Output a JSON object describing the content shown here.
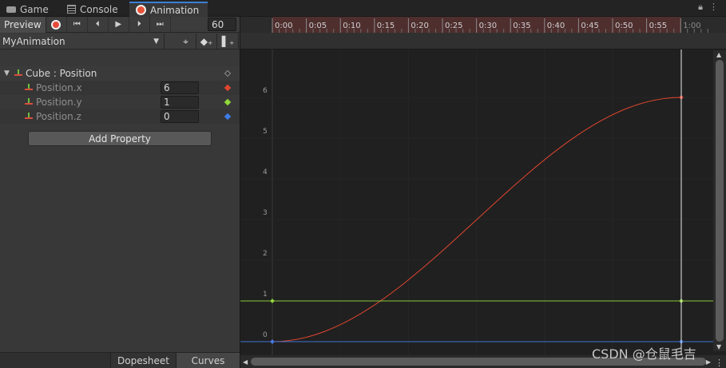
{
  "tabs": [
    {
      "label": "Game",
      "icon": "game-icon"
    },
    {
      "label": "Console",
      "icon": "console-icon"
    },
    {
      "label": "Animation",
      "icon": "animation-icon",
      "active": true
    }
  ],
  "toolbar": {
    "preview_label": "Preview",
    "frame_value": "60"
  },
  "clip": {
    "name": "MyAnimation"
  },
  "properties": {
    "group_label": "Cube : Position",
    "items": [
      {
        "label": "Position.x",
        "value": "6",
        "color": "#e0452f"
      },
      {
        "label": "Position.y",
        "value": "1",
        "color": "#8fd93a"
      },
      {
        "label": "Position.z",
        "value": "0",
        "color": "#3e7be6"
      }
    ],
    "add_label": "Add Property"
  },
  "bottom_tabs": {
    "dopesheet": "Dopesheet",
    "curves": "Curves"
  },
  "timeline": {
    "labels": [
      "0:00",
      "0:05",
      "0:10",
      "0:15",
      "0:20",
      "0:25",
      "0:30",
      "0:35",
      "0:40",
      "0:45",
      "0:50",
      "0:55",
      "1:00"
    ]
  },
  "graph": {
    "y_labels": [
      "6",
      "5",
      "4",
      "3",
      "2",
      "1",
      "0"
    ],
    "curves": [
      {
        "name": "Position.x",
        "color": "#e0452f",
        "start_value": 0,
        "end_value": 6
      },
      {
        "name": "Position.y",
        "color": "#8fd93a",
        "start_value": 1,
        "end_value": 1
      },
      {
        "name": "Position.z",
        "color": "#3e7be6",
        "start_value": 0,
        "end_value": 0
      }
    ]
  },
  "watermark": "CSDN @仓鼠毛吉"
}
